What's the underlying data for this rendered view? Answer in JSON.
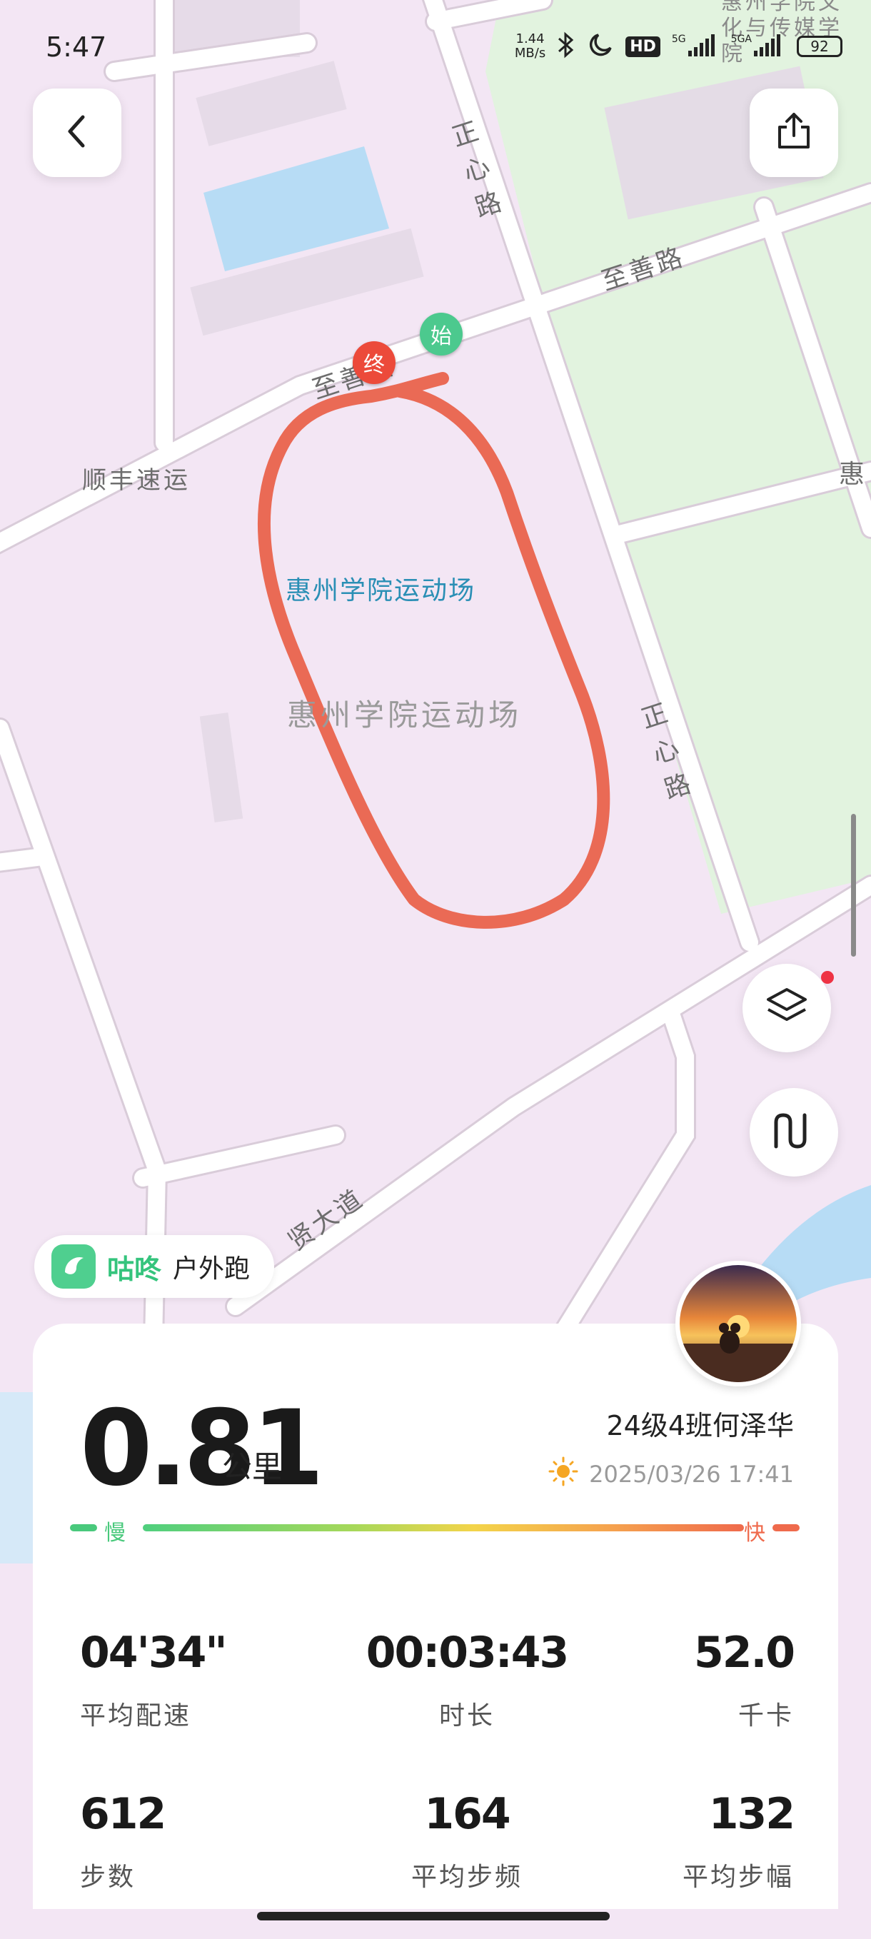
{
  "status_bar": {
    "time": "5:47",
    "net_speed_value": "1.44",
    "net_speed_unit": "MB/s",
    "hd_label": "HD",
    "sim1_label": "5G",
    "sim2_label": "5GA",
    "battery": "92"
  },
  "map": {
    "labels": {
      "road_top_right": "至善路",
      "road_top_left": "至善路",
      "road_zhengxin_1": "正心路",
      "road_zhengxin_2": "正心路",
      "company": "顺丰速运",
      "venue_blue": "惠州学院运动场",
      "venue_gray": "惠州学院运动场",
      "avenue": "贤大道",
      "corner_top": "惠州学院文化与传媒学院",
      "corner_right": "惠"
    },
    "start_pin": "始",
    "end_pin": "终",
    "colors": {
      "route": "#ea6a55",
      "start": "#4cc98e",
      "end": "#ec4a3a",
      "green_area": "#e2f3df",
      "water": "#b7dcf5"
    }
  },
  "brand": {
    "name": "咕咚",
    "activity": "户外跑"
  },
  "summary": {
    "distance": "0.81",
    "unit": "公里",
    "user": "24级4班何泽华",
    "datetime": "2025/03/26 17:41",
    "pace_slow": "慢",
    "pace_fast": "快"
  },
  "stats": [
    {
      "value": "04'34\"",
      "label": "平均配速"
    },
    {
      "value": "00:03:43",
      "label": "时长"
    },
    {
      "value": "52.0",
      "label": "千卡"
    },
    {
      "value": "612",
      "label": "步数"
    },
    {
      "value": "164",
      "label": "平均步频"
    },
    {
      "value": "132",
      "label": "平均步幅"
    }
  ],
  "icons": [
    "back-arrow-icon",
    "share-icon",
    "layers-icon",
    "route-toggle-icon",
    "sun-icon",
    "brand-logo-icon"
  ]
}
